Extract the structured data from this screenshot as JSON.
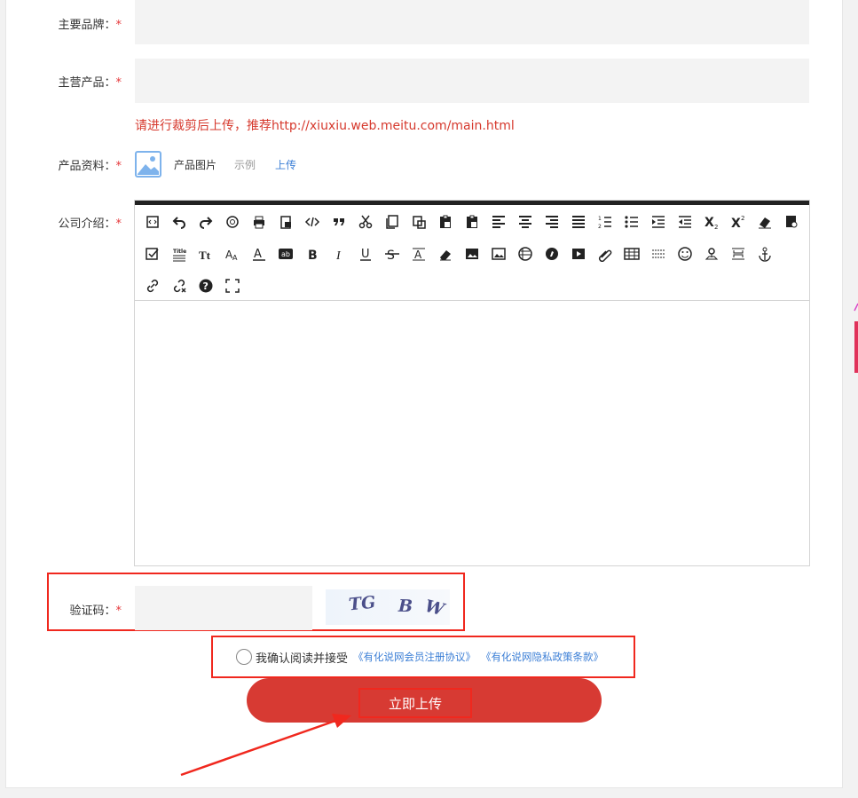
{
  "form": {
    "brand": {
      "label": "主要品牌：",
      "required": "*",
      "value": ""
    },
    "product": {
      "label": "主营产品：",
      "required": "*",
      "value": ""
    },
    "tip": "请进行裁剪后上传，推荐http://xiuxiu.web.meitu.com/main.html",
    "materials": {
      "label": "产品资料：",
      "required": "*",
      "image_icon": "image-placeholder-icon",
      "image_label": "产品图片",
      "sample_link": "示例",
      "upload_link": "上传"
    },
    "intro": {
      "label": "公司介绍：",
      "required": "*"
    },
    "captcha": {
      "label": "验证码：",
      "required": "*",
      "value": "",
      "image_chars": [
        "TG",
        "B",
        "W"
      ]
    },
    "agreement": {
      "text": "我确认阅读并接受",
      "link1": "《有化说网会员注册协议》",
      "link2": "《有化说网隐私政策条款》"
    },
    "submit_label": "立即上传"
  },
  "editor_toolbar": [
    "source-icon",
    "undo-icon",
    "redo-icon",
    "preview-icon",
    "print-icon",
    "paste-word-icon",
    "code-icon",
    "blockquote-icon",
    "cut-icon",
    "copy-icon",
    "paste-icon",
    "paste-text-icon",
    "paste-word-doc-icon",
    "align-left-icon",
    "align-center-icon",
    "align-right-icon",
    "align-justify-icon",
    "ordered-list-icon",
    "unordered-list-icon",
    "indent-icon",
    "outdent-icon",
    "subscript-icon",
    "superscript-icon",
    "clear-format-icon",
    "select-all-icon",
    "check-icon",
    "title-icon",
    "font-family-icon",
    "font-size-icon",
    "font-color-icon",
    "background-color-icon",
    "bold-icon",
    "italic-icon",
    "underline-icon",
    "strikethrough-icon",
    "line-height-icon",
    "eraser-icon",
    "image-icon",
    "multi-image-icon",
    "flash-icon",
    "media-icon",
    "video-icon",
    "insert-file-icon",
    "table-icon",
    "hr-icon",
    "emoticon-icon",
    "map-icon",
    "page-break-icon",
    "anchor-icon",
    "link-icon",
    "unlink-icon",
    "help-icon",
    "fullscreen-icon"
  ],
  "colors": {
    "required": "#e5373a",
    "tip": "#d6392d",
    "link": "#3c7fd6",
    "submit": "#d73a33",
    "annotation": "#f0281e"
  }
}
